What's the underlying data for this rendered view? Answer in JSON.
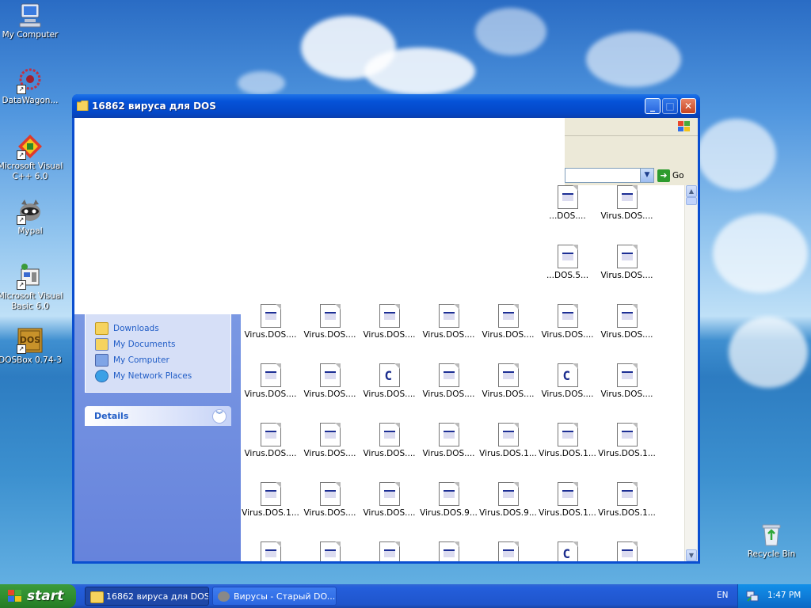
{
  "desktop": {
    "icons": [
      {
        "label": "My Computer"
      },
      {
        "label": "DataWagon..."
      },
      {
        "label": "Microsoft Visual C++ 6.0"
      },
      {
        "label": "Mypal"
      },
      {
        "label": "Microsoft Visual Basic 6.0"
      },
      {
        "label": "DOSBox 0.74-3"
      },
      {
        "label": "Recycle Bin"
      }
    ],
    "dosbox_logo_text": "DOS"
  },
  "window": {
    "title": "16862 вируса для DOS",
    "minimize_symbol": "_",
    "maximize_symbol": "□",
    "close_symbol": "✕",
    "address": {
      "go_label": "Go",
      "go_arrow": "➜",
      "dropdown_symbol": "▼"
    },
    "places": [
      {
        "label": "Downloads",
        "icon": "folder-icon"
      },
      {
        "label": "My Documents",
        "icon": "my-documents-icon"
      },
      {
        "label": "My Computer",
        "icon": "computer-icon"
      },
      {
        "label": "My Network Places",
        "icon": "network-icon"
      }
    ],
    "details_label": "Details",
    "details_chevron": "︾",
    "scroll_up_symbol": "▲",
    "scroll_down_symbol": "▼",
    "files": [
      {
        "row": 0,
        "col": 5,
        "name": "...DOS....",
        "type": "exe"
      },
      {
        "row": 0,
        "col": 6,
        "name": "Virus.DOS....",
        "type": "exe"
      },
      {
        "row": 1,
        "col": 5,
        "name": "...DOS.5...",
        "type": "exe"
      },
      {
        "row": 1,
        "col": 6,
        "name": "Virus.DOS....",
        "type": "exe"
      },
      {
        "row": 2,
        "col": 0,
        "name": "Virus.DOS....",
        "type": "exe"
      },
      {
        "row": 2,
        "col": 1,
        "name": "Virus.DOS....",
        "type": "exe"
      },
      {
        "row": 2,
        "col": 2,
        "name": "Virus.DOS....",
        "type": "exe"
      },
      {
        "row": 2,
        "col": 3,
        "name": "Virus.DOS....",
        "type": "exe"
      },
      {
        "row": 2,
        "col": 4,
        "name": "Virus.DOS....",
        "type": "exe"
      },
      {
        "row": 2,
        "col": 5,
        "name": "Virus.DOS....",
        "type": "exe"
      },
      {
        "row": 2,
        "col": 6,
        "name": "Virus.DOS....",
        "type": "exe"
      },
      {
        "row": 3,
        "col": 0,
        "name": "Virus.DOS....",
        "type": "exe"
      },
      {
        "row": 3,
        "col": 1,
        "name": "Virus.DOS....",
        "type": "exe"
      },
      {
        "row": 3,
        "col": 2,
        "name": "Virus.DOS....",
        "type": "c"
      },
      {
        "row": 3,
        "col": 3,
        "name": "Virus.DOS....",
        "type": "exe"
      },
      {
        "row": 3,
        "col": 4,
        "name": "Virus.DOS....",
        "type": "exe"
      },
      {
        "row": 3,
        "col": 5,
        "name": "Virus.DOS....",
        "type": "c"
      },
      {
        "row": 3,
        "col": 6,
        "name": "Virus.DOS....",
        "type": "exe"
      },
      {
        "row": 4,
        "col": 0,
        "name": "Virus.DOS....",
        "type": "exe"
      },
      {
        "row": 4,
        "col": 1,
        "name": "Virus.DOS....",
        "type": "exe"
      },
      {
        "row": 4,
        "col": 2,
        "name": "Virus.DOS....",
        "type": "exe"
      },
      {
        "row": 4,
        "col": 3,
        "name": "Virus.DOS....",
        "type": "exe"
      },
      {
        "row": 4,
        "col": 4,
        "name": "Virus.DOS.1...",
        "type": "exe"
      },
      {
        "row": 4,
        "col": 5,
        "name": "Virus.DOS.1...",
        "type": "exe"
      },
      {
        "row": 4,
        "col": 6,
        "name": "Virus.DOS.1...",
        "type": "exe"
      },
      {
        "row": 5,
        "col": 0,
        "name": "Virus.DOS.1...",
        "type": "exe"
      },
      {
        "row": 5,
        "col": 1,
        "name": "Virus.DOS....",
        "type": "exe"
      },
      {
        "row": 5,
        "col": 2,
        "name": "Virus.DOS....",
        "type": "exe"
      },
      {
        "row": 5,
        "col": 3,
        "name": "Virus.DOS.9...",
        "type": "exe"
      },
      {
        "row": 5,
        "col": 4,
        "name": "Virus.DOS.9...",
        "type": "exe"
      },
      {
        "row": 5,
        "col": 5,
        "name": "Virus.DOS.1...",
        "type": "exe"
      },
      {
        "row": 5,
        "col": 6,
        "name": "Virus.DOS.1...",
        "type": "exe"
      },
      {
        "row": 6,
        "col": 0,
        "name": "",
        "type": "exe"
      },
      {
        "row": 6,
        "col": 1,
        "name": "",
        "type": "exe"
      },
      {
        "row": 6,
        "col": 2,
        "name": "",
        "type": "exe"
      },
      {
        "row": 6,
        "col": 3,
        "name": "",
        "type": "exe"
      },
      {
        "row": 6,
        "col": 4,
        "name": "",
        "type": "exe"
      },
      {
        "row": 6,
        "col": 5,
        "name": "",
        "type": "c"
      },
      {
        "row": 6,
        "col": 6,
        "name": "",
        "type": "exe"
      }
    ],
    "c_glyph": "C"
  },
  "taskbar": {
    "start_label": "start",
    "items": [
      {
        "label": "16862 вируса для DOS",
        "icon": "folder-icon"
      },
      {
        "label": "Вирусы - Старый DO...",
        "icon": "mypal-icon"
      }
    ],
    "language": "EN",
    "clock": "1:47 PM"
  },
  "colors": {
    "title_blue": "#0552d8",
    "sidebar_blue": "#6f8ee0",
    "link_blue": "#215dc6",
    "start_green": "#2f8f2f",
    "tray_blue": "#0f7dd9"
  }
}
